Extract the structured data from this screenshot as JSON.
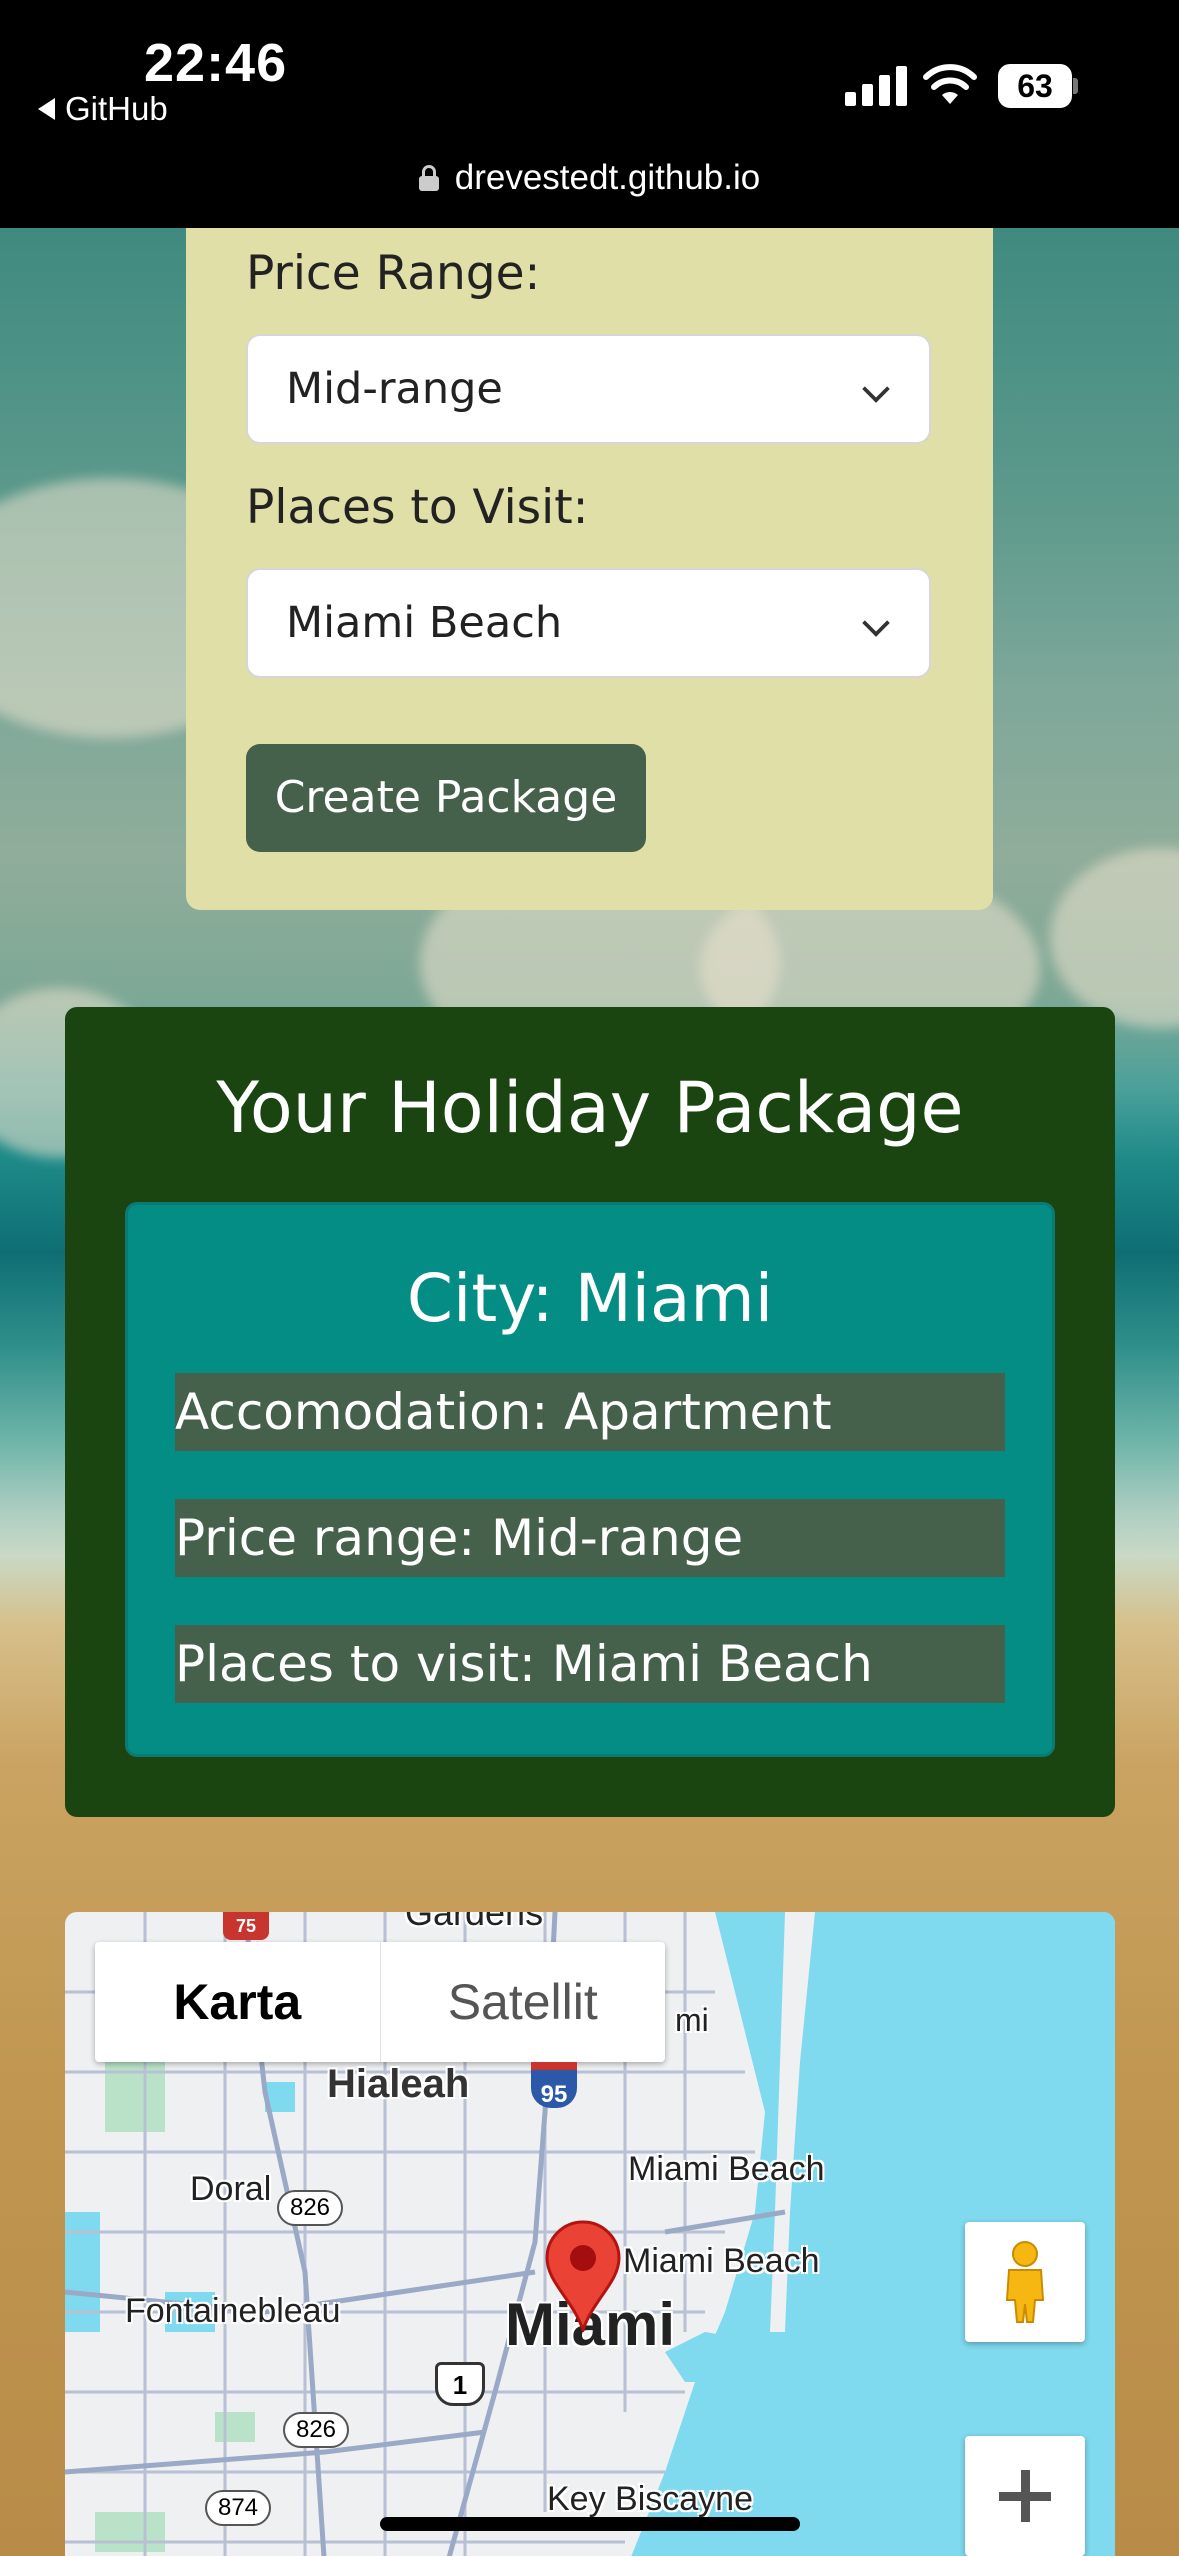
{
  "status_bar": {
    "time": "22:46",
    "back_app": "GitHub",
    "battery": "63"
  },
  "browser": {
    "url": "drevestedt.github.io"
  },
  "form": {
    "price_label": "Price Range:",
    "price_value": "Mid-range",
    "places_label": "Places to Visit:",
    "places_value": "Miami Beach",
    "create_button": "Create Package",
    "colors": {
      "card_bg": "#e0dfa7",
      "button_bg": "#45604b"
    }
  },
  "package": {
    "title": "Your Holiday Package",
    "city": "City: Miami",
    "rows": [
      "Accomodation: Apartment",
      "Price range: Mid-range",
      "Places to visit: Miami Beach"
    ],
    "colors": {
      "outer_bg": "#1b4510",
      "inner_bg": "#048d85",
      "row_bg": "#45604b"
    }
  },
  "map": {
    "type_buttons": [
      "Karta",
      "Satellit"
    ],
    "active_type": "Karta",
    "labels": {
      "gardens": "Gardens",
      "hialeah": "Hialeah",
      "doral": "Doral",
      "miami_beach_1": "Miami Beach",
      "miami_beach_2": "Miami Beach",
      "fontainebleau": "Fontainebleau",
      "miami": "Miami",
      "key_biscayne": "Key Biscayne",
      "mi": "mi"
    },
    "shields": {
      "r826a": "826",
      "r826b": "826",
      "r874": "874",
      "i95": "95",
      "us1": "1",
      "i75": "75"
    },
    "water_color": "#7fd9ef"
  }
}
